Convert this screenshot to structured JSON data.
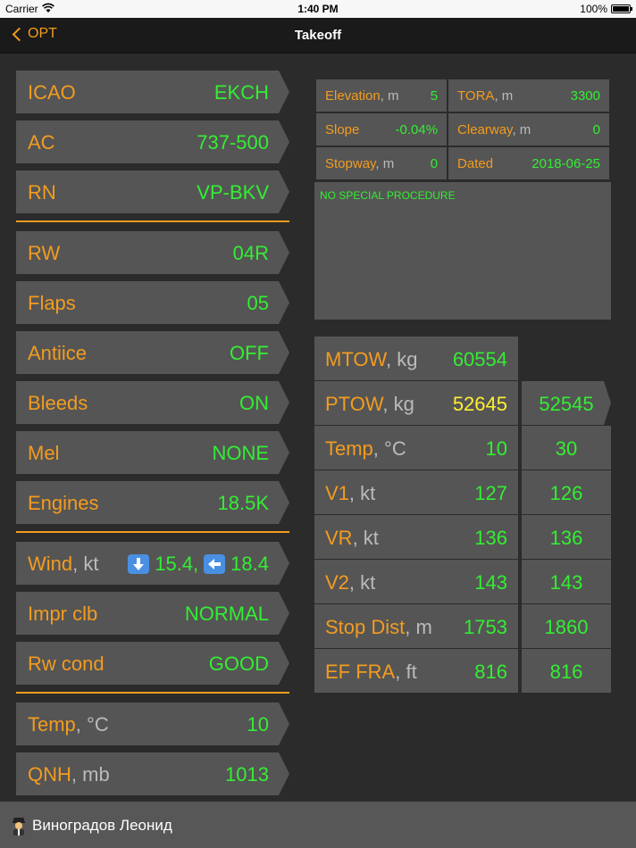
{
  "status": {
    "carrier": "Carrier",
    "time": "1:40 PM",
    "battery": "100%"
  },
  "nav": {
    "back": "OPT",
    "title": "Takeoff"
  },
  "fields": {
    "icao": {
      "label": "ICAO",
      "value": "EKCH"
    },
    "ac": {
      "label": "AC",
      "value": "737-500"
    },
    "rn": {
      "label": "RN",
      "value": "VP-BKV"
    },
    "rw": {
      "label": "RW",
      "value": "04R"
    },
    "flaps": {
      "label": "Flaps",
      "value": "05"
    },
    "antiice": {
      "label": "Antiice",
      "value": "OFF"
    },
    "bleeds": {
      "label": "Bleeds",
      "value": "ON"
    },
    "mel": {
      "label": "Mel",
      "value": "NONE"
    },
    "engines": {
      "label": "Engines",
      "value": "18.5K"
    },
    "wind": {
      "label": "Wind",
      "unit": ", kt",
      "headwind": "15.4,",
      "crosswind": "18.4"
    },
    "impr_clb": {
      "label": "Impr clb",
      "value": "NORMAL"
    },
    "rw_cond": {
      "label": "Rw cond",
      "value": "GOOD"
    },
    "temp": {
      "label": "Temp",
      "unit": ", °C",
      "value": "10"
    },
    "qnh": {
      "label": "QNH",
      "unit": ", mb",
      "value": "1013"
    }
  },
  "runway_info": {
    "elevation": {
      "label": "Elevation",
      "unit": ", m",
      "value": "5"
    },
    "tora": {
      "label": "TORA",
      "unit": ", m",
      "value": "3300"
    },
    "slope": {
      "label": "Slope",
      "value": "-0.04%"
    },
    "clearway": {
      "label": "Clearway",
      "unit": ", m",
      "value": "0"
    },
    "stopway": {
      "label": "Stopway",
      "unit": ", m",
      "value": "0"
    },
    "dated": {
      "label": "Dated",
      "value": "2018-06-25"
    }
  },
  "procedure": "NO SPECIAL PROCEDURE",
  "perf": {
    "mtow": {
      "label": "MTOW",
      "unit": ", kg",
      "value": "60554"
    },
    "ptow": {
      "label": "PTOW",
      "unit": ", kg",
      "value": "52645",
      "alt": "52545"
    },
    "temp": {
      "label": "Temp",
      "unit": ", °C",
      "value": "10",
      "alt": "30"
    },
    "v1": {
      "label": "V1",
      "unit": ", kt",
      "value": "127",
      "alt": "126"
    },
    "vr": {
      "label": "VR",
      "unit": ", kt",
      "value": "136",
      "alt": "136"
    },
    "v2": {
      "label": "V2",
      "unit": ", kt",
      "value": "143",
      "alt": "143"
    },
    "stop_dist": {
      "label": "Stop Dist",
      "unit": ", m",
      "value": "1753",
      "alt": "1860"
    },
    "ef_fra": {
      "label": "EF FRA",
      "unit": ", ft",
      "value": "816",
      "alt": "816"
    }
  },
  "user": {
    "name": "Виноградов Леонид"
  },
  "colors": {
    "accent": "#f39c1f",
    "value_green": "#33ee33",
    "value_yellow": "#ffee33",
    "cell_bg": "#555555",
    "background": "#2b2b2b"
  },
  "icons": {
    "wind_head": "arrow-down-icon",
    "wind_cross": "arrow-left-icon",
    "user": "pilot-icon",
    "back": "chevron-left-icon"
  }
}
